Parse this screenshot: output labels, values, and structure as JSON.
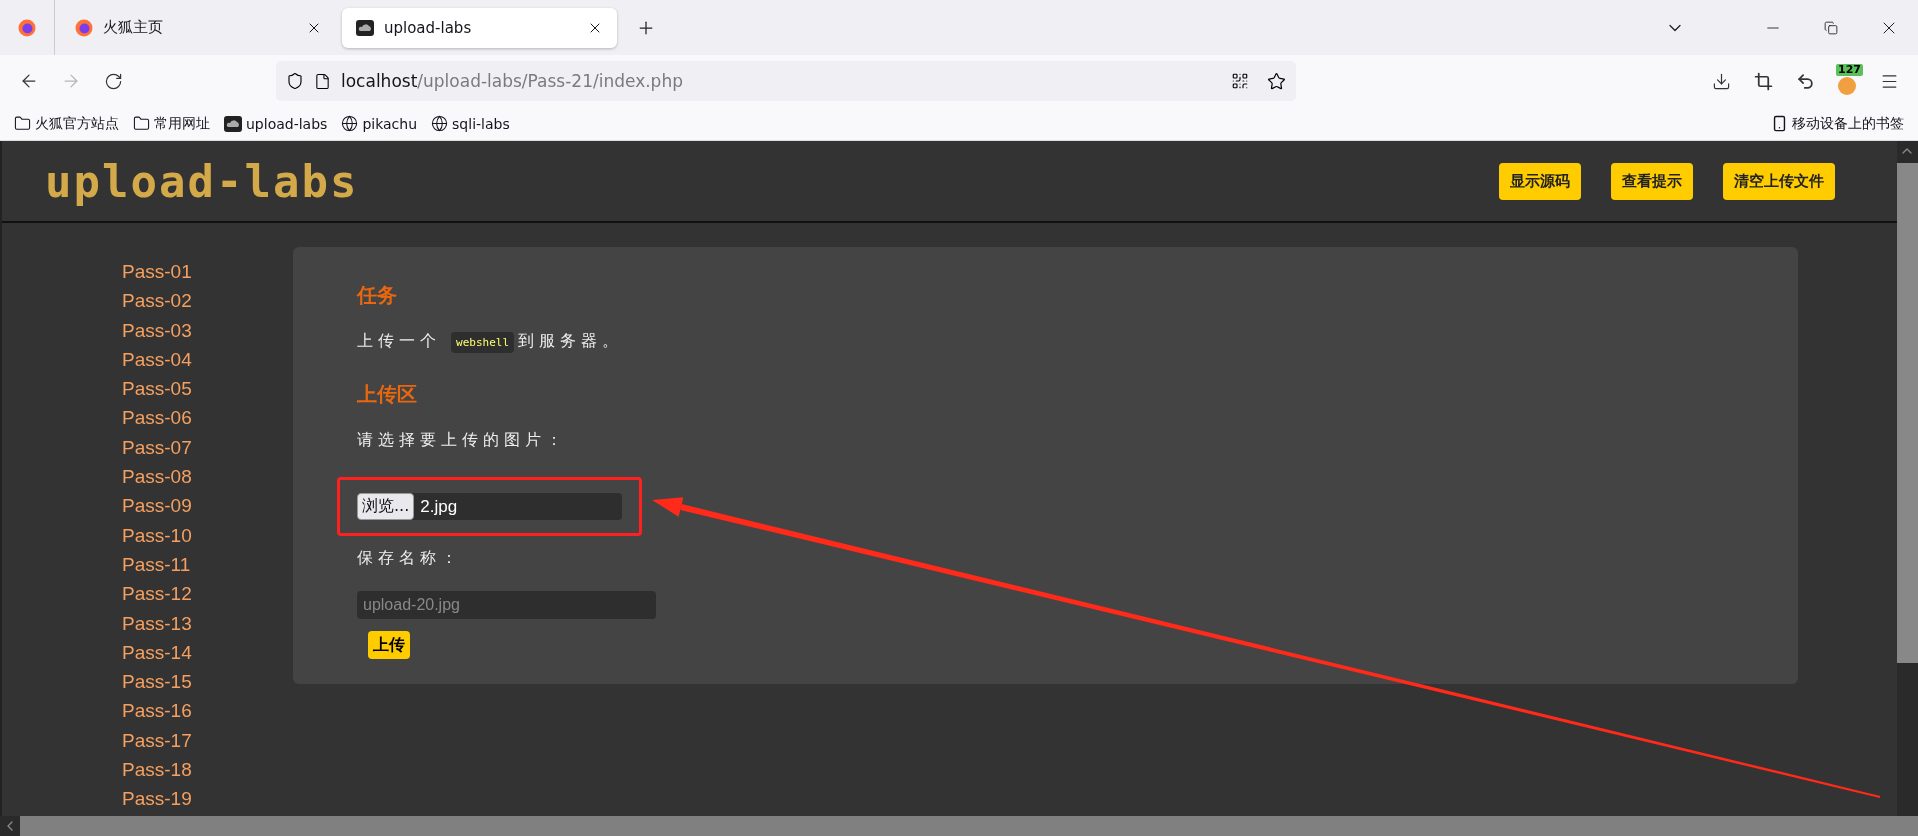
{
  "browser": {
    "tabs": [
      {
        "kind": "pinned",
        "selected": false
      },
      {
        "kind": "page",
        "label": "火狐主页",
        "selected": false
      },
      {
        "kind": "page",
        "label": "upload-labs",
        "selected": true
      }
    ],
    "forward": {
      "disabled": true
    },
    "url": {
      "host": "localhost",
      "path": "/upload-labs/Pass-21/index.php"
    },
    "extension_badge": "127",
    "bookmarks": [
      {
        "kind": "folder",
        "label": "火狐官方站点"
      },
      {
        "kind": "folder",
        "label": "常用网址"
      },
      {
        "kind": "site",
        "label": "upload-labs"
      },
      {
        "kind": "globe",
        "label": "pikachu"
      },
      {
        "kind": "globe",
        "label": "sqli-labs"
      }
    ],
    "mobile_bookmarks": "移动设备上的书签"
  },
  "page": {
    "logo": "upload-labs",
    "header_buttons": [
      "显示源码",
      "查看提示",
      "清空上传文件"
    ],
    "sidebar": {
      "items": [
        "Pass-01",
        "Pass-02",
        "Pass-03",
        "Pass-04",
        "Pass-05",
        "Pass-06",
        "Pass-07",
        "Pass-08",
        "Pass-09",
        "Pass-10",
        "Pass-11",
        "Pass-12",
        "Pass-13",
        "Pass-14",
        "Pass-15",
        "Pass-16",
        "Pass-17",
        "Pass-18",
        "Pass-19"
      ]
    },
    "task": {
      "heading": "任务",
      "before": "上传一个",
      "code": "webshell",
      "after": "到服务器。"
    },
    "upload": {
      "heading": "上传区",
      "prompt": "请选择要上传的图片：",
      "browse_button": "浏览...",
      "file_name": "2.jpg",
      "save_label": "保存名称：",
      "save_name": "upload-20.jpg",
      "submit": "上传"
    }
  }
}
